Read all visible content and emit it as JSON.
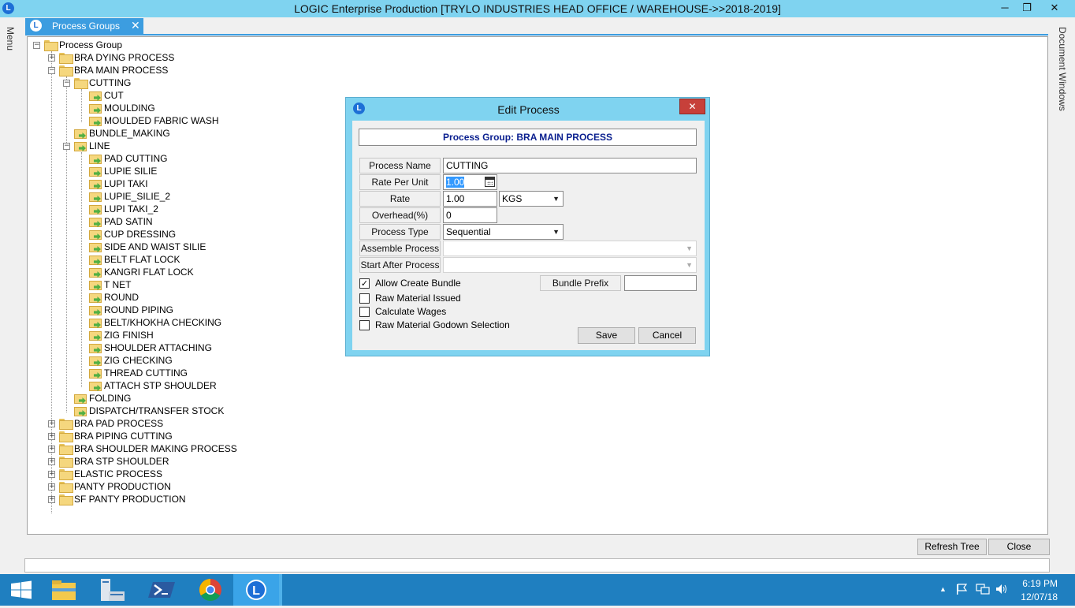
{
  "window": {
    "app_icon": "L",
    "title": "LOGIC Enterprise Production  [TRYLO INDUSTRIES HEAD OFFICE / WAREHOUSE->>2018-2019]",
    "minimize": "─",
    "maximize": "❐",
    "close": "✕"
  },
  "side": {
    "menu": "Menu",
    "document_windows": "Document Windows"
  },
  "tab": {
    "label": "Process Groups",
    "close": "✕"
  },
  "tree": {
    "root": "Process Group",
    "items": [
      {
        "label": "BRA DYING PROCESS"
      },
      {
        "label": "BRA MAIN PROCESS"
      },
      {
        "label": "CUTTING"
      },
      {
        "label": "CUT"
      },
      {
        "label": "MOULDING"
      },
      {
        "label": "MOULDED FABRIC WASH"
      },
      {
        "label": "BUNDLE_MAKING"
      },
      {
        "label": "LINE"
      },
      {
        "label": "PAD CUTTING"
      },
      {
        "label": "LUPIE SILIE"
      },
      {
        "label": "LUPI TAKI"
      },
      {
        "label": "LUPIE_SILIE_2"
      },
      {
        "label": "LUPI TAKI_2"
      },
      {
        "label": "PAD SATIN"
      },
      {
        "label": "CUP DRESSING"
      },
      {
        "label": "SIDE AND WAIST SILIE"
      },
      {
        "label": "BELT FLAT LOCK"
      },
      {
        "label": "KANGRI FLAT LOCK"
      },
      {
        "label": "T NET"
      },
      {
        "label": "ROUND"
      },
      {
        "label": "ROUND PIPING"
      },
      {
        "label": "BELT/KHOKHA CHECKING"
      },
      {
        "label": "ZIG FINISH"
      },
      {
        "label": "SHOULDER ATTACHING"
      },
      {
        "label": "ZIG CHECKING"
      },
      {
        "label": "THREAD CUTTING"
      },
      {
        "label": "ATTACH STP SHOULDER"
      },
      {
        "label": "FOLDING"
      },
      {
        "label": "DISPATCH/TRANSFER STOCK"
      },
      {
        "label": "BRA PAD PROCESS"
      },
      {
        "label": "BRA PIPING CUTTING"
      },
      {
        "label": "BRA SHOULDER MAKING PROCESS"
      },
      {
        "label": "BRA STP SHOULDER"
      },
      {
        "label": "ELASTIC PROCESS"
      },
      {
        "label": "PANTY PRODUCTION"
      },
      {
        "label": "SF PANTY PRODUCTION"
      }
    ]
  },
  "buttons": {
    "refresh_tree": "Refresh Tree",
    "close": "Close"
  },
  "dialog": {
    "icon": "L",
    "title": "Edit Process",
    "close": "✕",
    "group_header": "Process Group: BRA MAIN PROCESS",
    "labels": {
      "process_name": "Process Name",
      "rate_per_unit": "Rate Per Unit",
      "rate": "Rate",
      "overhead": "Overhead(%)",
      "process_type": "Process Type",
      "assemble_process": "Assemble Process",
      "start_after_process": "Start After Process",
      "bundle_prefix": "Bundle Prefix"
    },
    "values": {
      "process_name": "CUTTING",
      "rate_per_unit": "1.00",
      "rate": "1.00",
      "rate_unit": "KGS",
      "overhead": "0",
      "process_type": "Sequential",
      "assemble_process": "",
      "start_after_process": "",
      "bundle_prefix": ""
    },
    "checks": [
      {
        "label": "Allow Create Bundle",
        "checked": true
      },
      {
        "label": "Raw Material Issued",
        "checked": false
      },
      {
        "label": "Calculate Wages",
        "checked": false
      },
      {
        "label": "Raw Material Godown Selection",
        "checked": false
      }
    ],
    "check_mark": "✓",
    "save": "Save",
    "cancel": "Cancel"
  },
  "taskbar": {
    "time": "6:19 PM",
    "date": "12/07/18",
    "apps": [
      "start-icon",
      "file-explorer-icon",
      "server-manager-icon",
      "powershell-icon",
      "chrome-icon",
      "logic-app-icon"
    ]
  },
  "colors": {
    "title_bar": "#7fd3f0",
    "tab": "#3c9de0",
    "taskbar": "#1f7fc0",
    "dialog_header_text": "#0a1f8f",
    "dialog_close": "#c7403a"
  }
}
